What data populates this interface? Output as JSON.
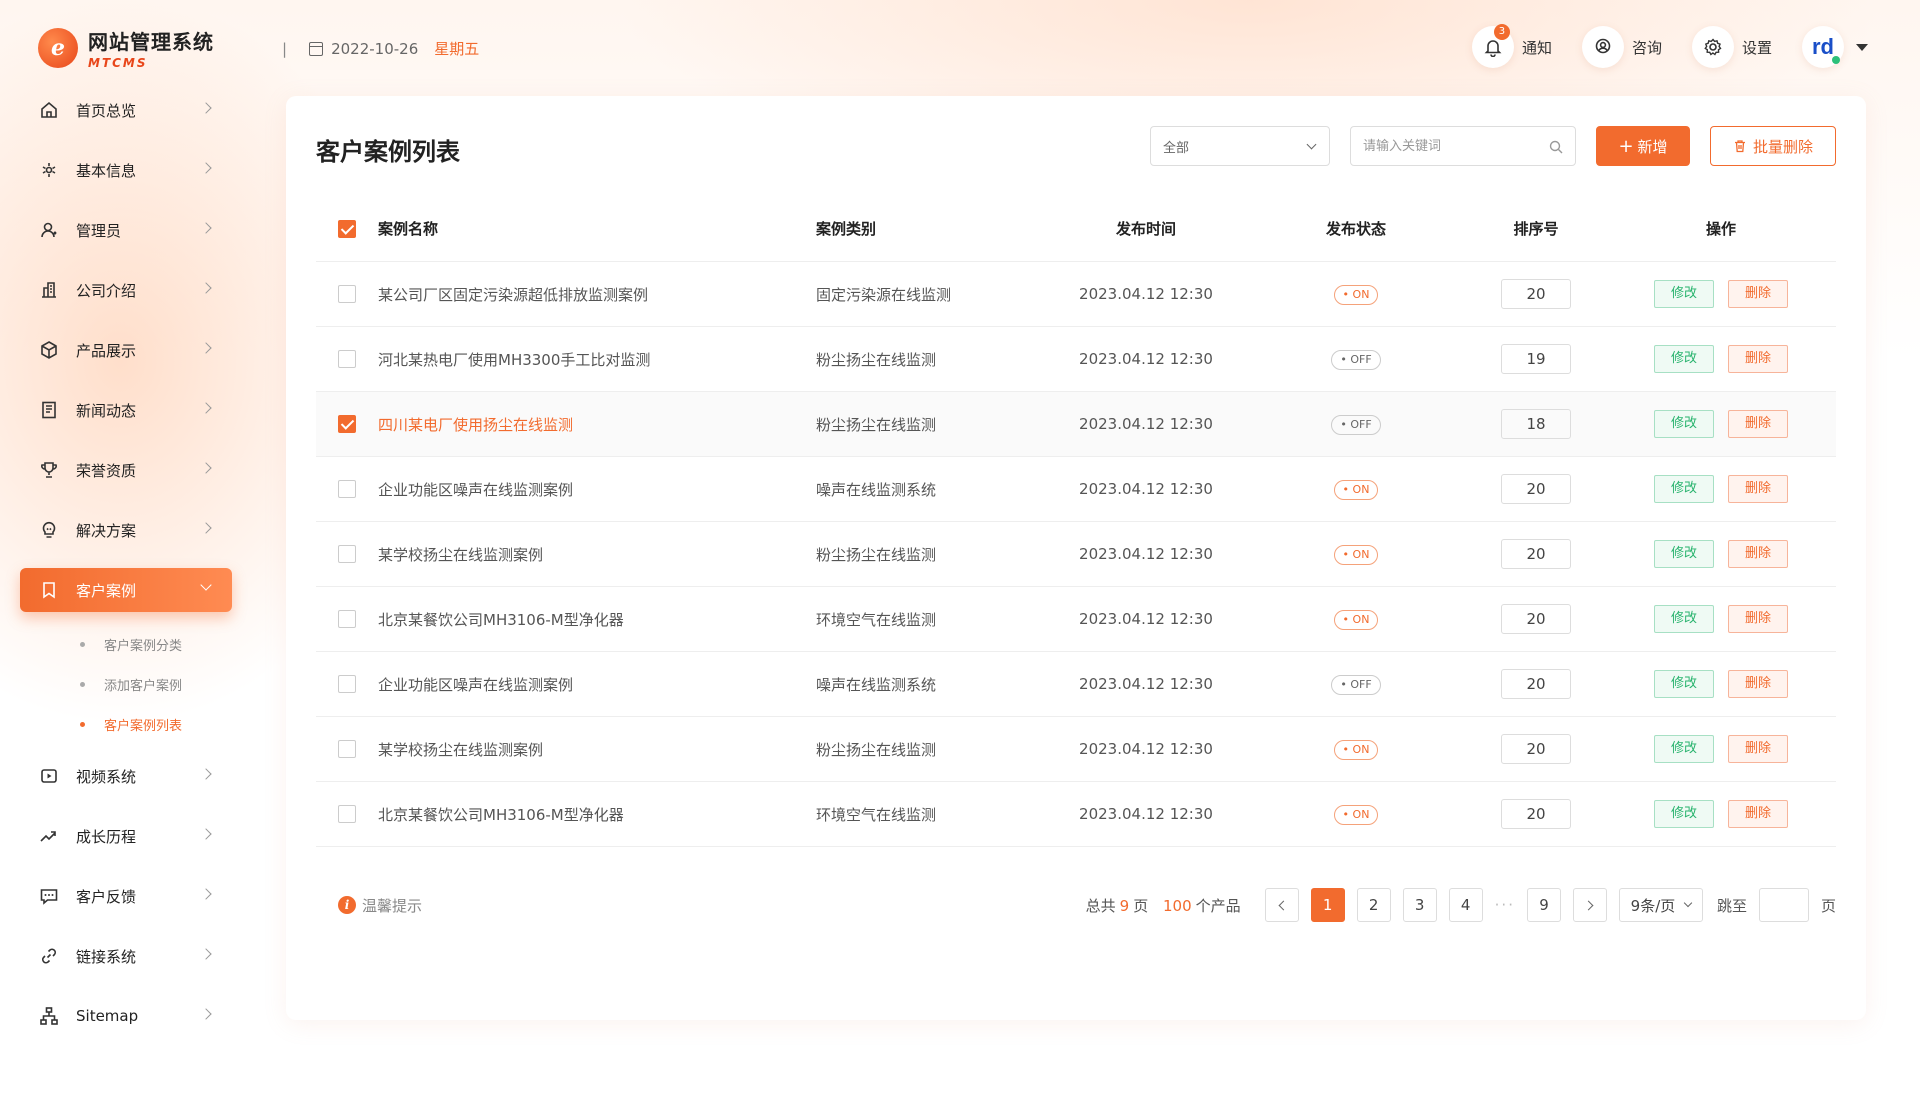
{
  "app": {
    "logo_mark": "e",
    "name_cn": "网站管理系统",
    "name_en": "MTCMS"
  },
  "header": {
    "separator": "|",
    "date": "2022-10-26",
    "weekday": "星期五",
    "notify_label": "通知",
    "notify_badge": "3",
    "consult_label": "咨询",
    "settings_label": "设置",
    "avatar_text": "rd"
  },
  "sidebar": {
    "items": [
      {
        "label": "首页总览",
        "icon": "home-icon"
      },
      {
        "label": "基本信息",
        "icon": "info-icon"
      },
      {
        "label": "管理员",
        "icon": "user-icon"
      },
      {
        "label": "公司介绍",
        "icon": "building-icon"
      },
      {
        "label": "产品展示",
        "icon": "box-icon"
      },
      {
        "label": "新闻动态",
        "icon": "news-icon"
      },
      {
        "label": "荣誉资质",
        "icon": "trophy-icon"
      },
      {
        "label": "解决方案",
        "icon": "bulb-icon"
      },
      {
        "label": "客户案例",
        "icon": "bookmark-icon",
        "active": true
      },
      {
        "label": "视频系统",
        "icon": "video-icon"
      },
      {
        "label": "成长历程",
        "icon": "trend-icon"
      },
      {
        "label": "客户反馈",
        "icon": "feedback-icon"
      },
      {
        "label": "链接系统",
        "icon": "link-icon"
      },
      {
        "label": "Sitemap",
        "icon": "sitemap-icon"
      }
    ],
    "subitems": [
      {
        "label": "客户案例分类"
      },
      {
        "label": "添加客户案例"
      },
      {
        "label": "客户案例列表",
        "active": true
      }
    ]
  },
  "main": {
    "title": "客户案例列表",
    "filter_value": "全部",
    "search_placeholder": "请输入关键词",
    "add_label": "新增",
    "batch_delete_label": "批量删除",
    "columns": [
      "案例名称",
      "案例类别",
      "发布时间",
      "发布状态",
      "排序号",
      "操作"
    ],
    "rows": [
      {
        "name": "某公司厂区固定污染源超低排放监测案例",
        "type": "固定污染源在线监测",
        "time": "2023.04.12 12:30",
        "status": "ON",
        "sort": "20",
        "checked": false
      },
      {
        "name": "河北某热电厂使用MH3300手工比对监测",
        "type": "粉尘扬尘在线监测",
        "time": "2023.04.12 12:30",
        "status": "OFF",
        "sort": "19",
        "checked": false
      },
      {
        "name": "四川某电厂使用扬尘在线监测",
        "type": "粉尘扬尘在线监测",
        "time": "2023.04.12 12:30",
        "status": "OFF",
        "sort": "18",
        "checked": true
      },
      {
        "name": "企业功能区噪声在线监测案例",
        "type": "噪声在线监测系统",
        "time": "2023.04.12 12:30",
        "status": "ON",
        "sort": "20",
        "checked": false
      },
      {
        "name": "某学校扬尘在线监测案例",
        "type": "粉尘扬尘在线监测",
        "time": "2023.04.12 12:30",
        "status": "ON",
        "sort": "20",
        "checked": false
      },
      {
        "name": "北京某餐饮公司MH3106-M型净化器",
        "type": "环境空气在线监测",
        "time": "2023.04.12 12:30",
        "status": "ON",
        "sort": "20",
        "checked": false
      },
      {
        "name": "企业功能区噪声在线监测案例",
        "type": "噪声在线监测系统",
        "time": "2023.04.12 12:30",
        "status": "OFF",
        "sort": "20",
        "checked": false
      },
      {
        "name": "某学校扬尘在线监测案例",
        "type": "粉尘扬尘在线监测",
        "time": "2023.04.12 12:30",
        "status": "ON",
        "sort": "20",
        "checked": false
      },
      {
        "name": "北京某餐饮公司MH3106-M型净化器",
        "type": "环境空气在线监测",
        "time": "2023.04.12 12:30",
        "status": "ON",
        "sort": "20",
        "checked": false
      }
    ],
    "edit_label": "修改",
    "delete_label": "删除"
  },
  "footer": {
    "tip": "温馨提示",
    "total_prefix": "总共",
    "total_pages": "9",
    "total_pages_unit": "页",
    "total_items": "100",
    "total_items_unit": "个产品",
    "pages": [
      "1",
      "2",
      "3",
      "4"
    ],
    "dots": "···",
    "last_page": "9",
    "current_page": "1",
    "page_size": "9条/页",
    "jump_prefix": "跳至",
    "jump_suffix": "页"
  },
  "colors": {
    "accent": "#f26b2e",
    "success": "#27b36d"
  }
}
